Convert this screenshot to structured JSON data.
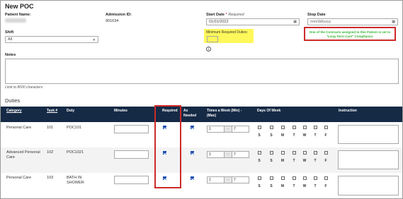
{
  "page": {
    "title": "New POC"
  },
  "patient": {
    "name_label": "Patient Name:",
    "admission_label": "Admission ID:",
    "admission_value": "901634"
  },
  "start_date": {
    "label": "Start Date",
    "required_mark": "*",
    "required_word": "Required",
    "value": "01/01/2022"
  },
  "stop_date": {
    "label": "Stop Date",
    "placeholder": "mm/dd/yyyy"
  },
  "min_duties": {
    "label": "Minimum Required Duties:",
    "info_symbol": "i"
  },
  "warning": {
    "line1": "One of the Contracts assigned to this Patient is set to",
    "line2": "\"Long Term Care\" Compliance."
  },
  "shift": {
    "label": "Shift",
    "selected": "All"
  },
  "notes": {
    "label": "Notes",
    "limit_hint": "Limit to 8000 characters"
  },
  "duties": {
    "section_title": "Duties",
    "columns": {
      "category": "Category",
      "task": "Task #",
      "duty": "Duty",
      "minutes": "Minutes",
      "required": "Required",
      "as_needed_1": "As",
      "as_needed_2": "Needed",
      "times_1": "Times a Week (Min) -",
      "times_2": "(Max)",
      "days": "Days Of Week",
      "instruction": "Instruction"
    },
    "day_letters": [
      "S",
      "S",
      "M",
      "T",
      "W",
      "T",
      "F"
    ],
    "rows": [
      {
        "category_1": "Personal Care",
        "category_2": "",
        "task": "101",
        "duty_1": "POC101",
        "duty_2": "",
        "min": "1",
        "max": "7",
        "required": true,
        "as_needed": true
      },
      {
        "category_1": "Advanced Personal",
        "category_2": "Care",
        "task": "102",
        "duty_1": "POC1021",
        "duty_2": "",
        "min": "1",
        "max": "7",
        "required": true,
        "as_needed": true
      },
      {
        "category_1": "Personal Care",
        "category_2": "",
        "task": "103",
        "duty_1": "BATH IN",
        "duty_2": "SHOWER",
        "min": "1",
        "max": "7",
        "required": true,
        "as_needed": true
      }
    ],
    "spin_separator": "-"
  },
  "colors": {
    "table_header": "#152a45",
    "highlight": "#fff85a",
    "warning_border": "#cc2a2a",
    "warning_text": "#2fb52f"
  }
}
